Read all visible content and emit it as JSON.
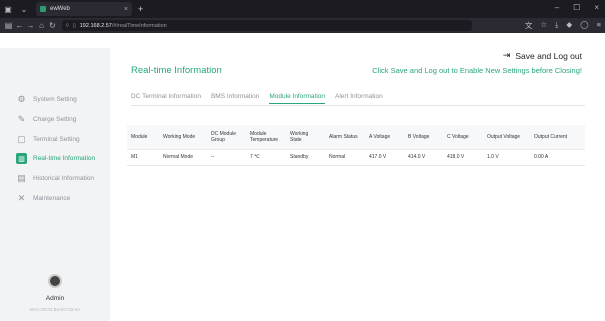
{
  "browser": {
    "tab_title": "ewWeb",
    "url_host": "192.168.2.57",
    "url_path": "/#/realTimeInformation"
  },
  "header": {
    "logout_label": "Save and Log out",
    "page_title": "Real-time Information",
    "hint": "Click Save and Log out to Enable New Settings before Closing!"
  },
  "sidebar": {
    "items": [
      {
        "label": "System Setting",
        "icon": "gear-icon"
      },
      {
        "label": "Charge Setting",
        "icon": "wrench-icon"
      },
      {
        "label": "Terminal Setting",
        "icon": "clipboard-icon"
      },
      {
        "label": "Real-time Information",
        "icon": "chart-icon"
      },
      {
        "label": "Historical Information",
        "icon": "history-icon"
      },
      {
        "label": "Maintenance",
        "icon": "tools-icon"
      }
    ],
    "active_index": 3,
    "user_name": "Admin",
    "mac": "MAC:00:04:B4:E0:CB:6A"
  },
  "tabs": [
    {
      "label": "DC Terminal Information"
    },
    {
      "label": "BMS Information"
    },
    {
      "label": "Module Information"
    },
    {
      "label": "Alert Information"
    }
  ],
  "active_tab": 2,
  "table": {
    "columns": [
      "Module",
      "Working Mode",
      "DC Module Group",
      "Module Temperature",
      "Working State",
      "Alarm Status",
      "A Voltage",
      "B Voltage",
      "C Voltage",
      "Output Voltage",
      "Output Current"
    ],
    "rows": [
      [
        "M1",
        "Normal Mode",
        "--",
        "7 ℃",
        "Standby",
        "Normal",
        "417.0 V",
        "414.0 V",
        "418.0 V",
        "1.0 V",
        "0.00 A"
      ]
    ]
  }
}
